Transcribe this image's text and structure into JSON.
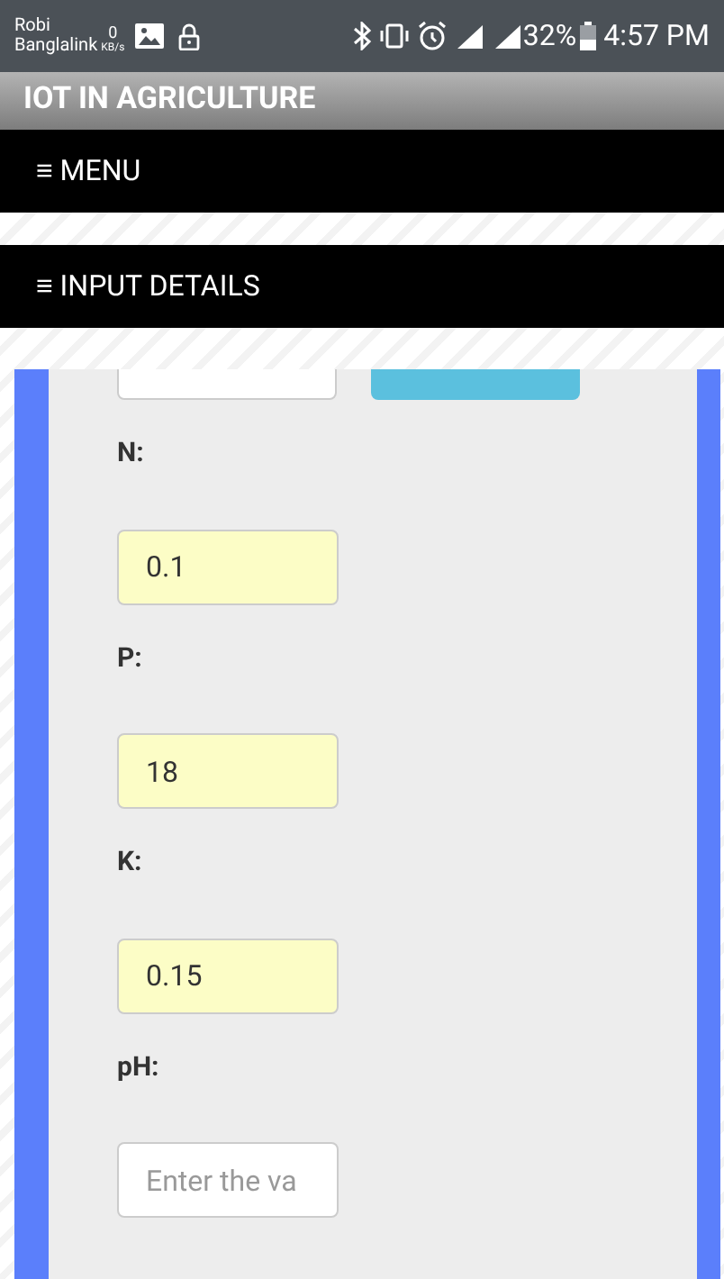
{
  "status_bar": {
    "carrier_1": "Robi",
    "carrier_2": "Banglalink",
    "speed_value": "0",
    "speed_unit": "KB/s",
    "battery": "32%",
    "time": "4:57 PM"
  },
  "app_title": "IOT IN AGRICULTURE",
  "menus": [
    {
      "icon": "≡",
      "label": "MENU"
    },
    {
      "icon": "≡",
      "label": "INPUT DETAILS"
    }
  ],
  "fields": [
    {
      "label": "N:",
      "value": "0.1",
      "autofilled": true
    },
    {
      "label": "P:",
      "value": "18",
      "autofilled": true
    },
    {
      "label": "K:",
      "value": "0.15",
      "autofilled": true
    },
    {
      "label": "pH:",
      "placeholder": "Enter the va",
      "autofilled": false
    }
  ]
}
